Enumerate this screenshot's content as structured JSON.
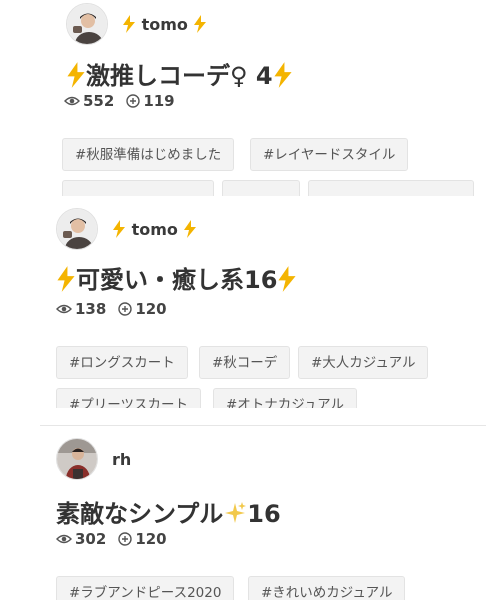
{
  "colors": {
    "bolt": "#f4b400",
    "sparkle": "#f2c94c",
    "tag_bg": "#f3f3f3",
    "divider": "#e6e6e6"
  },
  "posts": [
    {
      "username": "tomo",
      "title": "激推しコーデ♀ 4",
      "views": "552",
      "clips": "119",
      "tags": [
        "#秋服準備はじめました",
        "#レイヤードスタイル"
      ]
    },
    {
      "username": "tomo",
      "title": "可愛い・癒し系16",
      "views": "138",
      "clips": "120",
      "tags": [
        "#ロングスカート",
        "#秋コーデ",
        "#大人カジュアル",
        "#プリーツスカート",
        "#オトナカジュアル"
      ]
    },
    {
      "username": "rh",
      "title_main": "素敵なシンプル",
      "title_num": "16",
      "views": "302",
      "clips": "120",
      "tags": [
        "#ラブアンドピース2020",
        "#きれいめカジュアル"
      ]
    }
  ]
}
